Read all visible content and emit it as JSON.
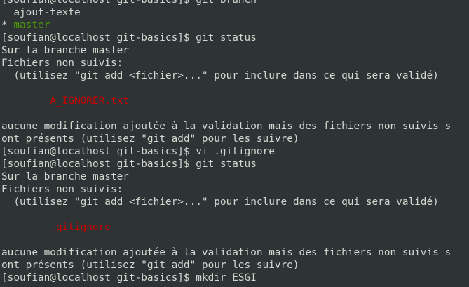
{
  "colors": {
    "background": "#2e3436",
    "default": "#d3d7cf",
    "green": "#4e9a06",
    "red": "#cc0000"
  },
  "terminal": {
    "lines": [
      {
        "text": "[soufian@localhost git-basics]$ git branch",
        "color": "default",
        "indent": 0
      },
      {
        "text": "ajout-texte",
        "color": "default",
        "indent": 2
      },
      {
        "text": "* ",
        "color": "default",
        "indent": 0,
        "suffix": "master",
        "suffix_color": "green"
      },
      {
        "text": "[soufian@localhost git-basics]$ git status",
        "color": "default",
        "indent": 0
      },
      {
        "text": "Sur la branche master",
        "color": "default",
        "indent": 0
      },
      {
        "text": "Fichiers non suivis:",
        "color": "default",
        "indent": 0
      },
      {
        "text": "(utilisez \"git add <fichier>...\" pour inclure dans ce qui sera validé)",
        "color": "default",
        "indent": 2
      },
      {
        "text": "",
        "color": "default",
        "indent": 0
      },
      {
        "text": "A_IGNORER.txt",
        "color": "red",
        "indent": 8
      },
      {
        "text": "",
        "color": "default",
        "indent": 0
      },
      {
        "text": "aucune modification ajoutée à la validation mais des fichiers non suivis s",
        "color": "default",
        "indent": 0
      },
      {
        "text": "ont présents (utilisez \"git add\" pour les suivre)",
        "color": "default",
        "indent": 0
      },
      {
        "text": "[soufian@localhost git-basics]$ vi .gitignore",
        "color": "default",
        "indent": 0
      },
      {
        "text": "[soufian@localhost git-basics]$ git status",
        "color": "default",
        "indent": 0
      },
      {
        "text": "Sur la branche master",
        "color": "default",
        "indent": 0
      },
      {
        "text": "Fichiers non suivis:",
        "color": "default",
        "indent": 0
      },
      {
        "text": "(utilisez \"git add <fichier>...\" pour inclure dans ce qui sera validé)",
        "color": "default",
        "indent": 2
      },
      {
        "text": "",
        "color": "default",
        "indent": 0
      },
      {
        "text": ".gitignore",
        "color": "red",
        "indent": 8
      },
      {
        "text": "",
        "color": "default",
        "indent": 0
      },
      {
        "text": "aucune modification ajoutée à la validation mais des fichiers non suivis s",
        "color": "default",
        "indent": 0
      },
      {
        "text": "ont présents (utilisez \"git add\" pour les suivre)",
        "color": "default",
        "indent": 0
      },
      {
        "text": "[soufian@localhost git-basics]$ mkdir ESGI",
        "color": "default",
        "indent": 0
      }
    ]
  }
}
